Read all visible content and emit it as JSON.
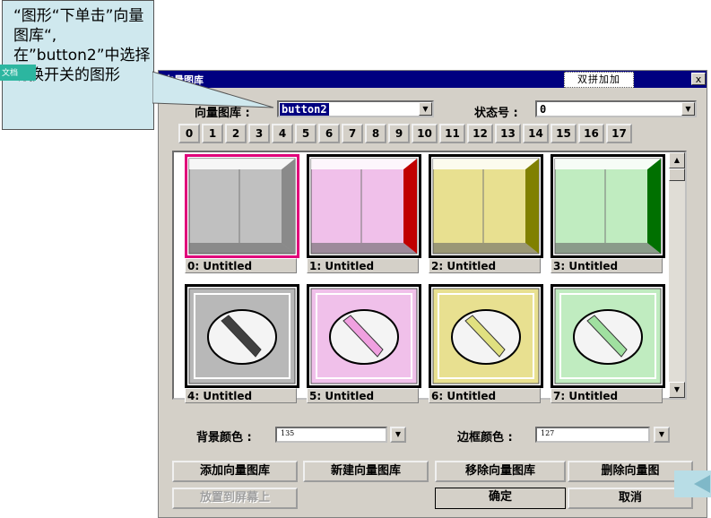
{
  "dialog": {
    "title": "向量图库",
    "ime_text": "双拼加加",
    "close_label": "x"
  },
  "library": {
    "label": "向量图库 :",
    "value": "button2"
  },
  "state": {
    "label": "状态号 :",
    "value": "0"
  },
  "state_buttons": [
    "0",
    "1",
    "2",
    "3",
    "4",
    "5",
    "6",
    "7",
    "8",
    "9",
    "10",
    "11",
    "12",
    "13",
    "14",
    "15",
    "16",
    "17"
  ],
  "tiles": [
    {
      "caption": "0: Untitled",
      "kind": "panel",
      "color": "#c0c0c0",
      "shade": "#8a8a8a",
      "selected": true
    },
    {
      "caption": "1: Untitled",
      "kind": "panel",
      "color": "#f0c0ea",
      "shade": "#c00000",
      "selected": false
    },
    {
      "caption": "2: Untitled",
      "kind": "panel",
      "color": "#e8e090",
      "shade": "#808000",
      "selected": false
    },
    {
      "caption": "3: Untitled",
      "kind": "panel",
      "color": "#c0ecc0",
      "shade": "#007000",
      "selected": false
    },
    {
      "caption": "4: Untitled",
      "kind": "knob",
      "color": "#b8b8b8",
      "knob": "#404040",
      "selected": false
    },
    {
      "caption": "5: Untitled",
      "kind": "knob",
      "color": "#f0c0ea",
      "knob": "#f0a0e0",
      "selected": false
    },
    {
      "caption": "6: Untitled",
      "kind": "knob",
      "color": "#e8e090",
      "knob": "#e0e080",
      "selected": false
    },
    {
      "caption": "7: Untitled",
      "kind": "knob",
      "color": "#c0ecc0",
      "knob": "#a0e0a0",
      "selected": false
    }
  ],
  "bg_color": {
    "label": "背景颜色 :",
    "value": "135"
  },
  "border_color": {
    "label": "边框颜色 :",
    "value": "127"
  },
  "buttons": {
    "add": "添加向量图库",
    "new": "新建向量图库",
    "remove": "移除向量图库",
    "delete": "删除向量图",
    "place": "放置到屏幕上",
    "ok": "确定",
    "cancel": "取消"
  },
  "callout": {
    "text": "“图形“下单击”向量图库“,在”button2”中选择切换开关的图形",
    "tag": "文档"
  },
  "colors": {
    "title_bar": "#000080",
    "dialog_bg": "#d4d0c8",
    "callout_bg": "#cfe8ee",
    "tag": "#2cb6a0"
  }
}
